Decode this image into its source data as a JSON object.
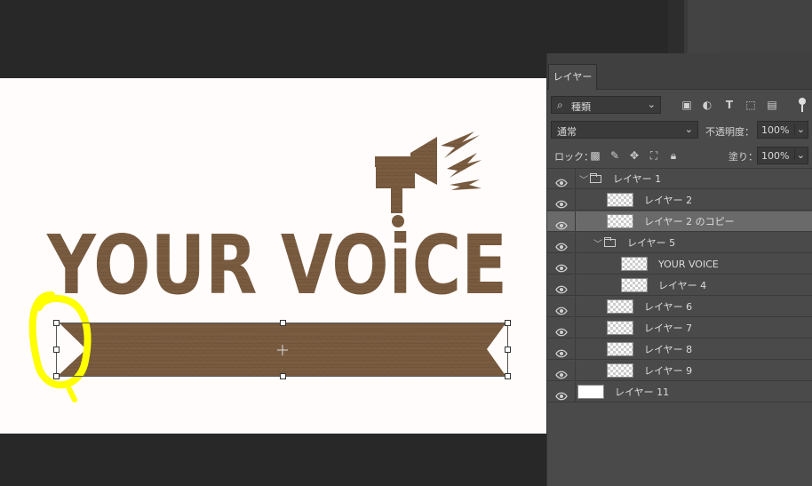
{
  "canvas": {
    "headline": "YOUR VOiCE",
    "text_color": "#7a5c40",
    "annotation_color": "#ffff00"
  },
  "panel": {
    "tab": "レイヤー",
    "filter_search_icon": "search-icon",
    "filter_kind": "種類",
    "blend_mode": "通常",
    "opacity_label": "不透明度：",
    "opacity_value": "100%",
    "lock_label": "ロック：",
    "fill_label": "塗り：",
    "fill_value": "100%",
    "layers": [
      {
        "name": "レイヤー 1",
        "type": "group",
        "indent": 0,
        "expanded": true
      },
      {
        "name": "レイヤー 2",
        "type": "layer",
        "indent": 1
      },
      {
        "name": "レイヤー 2 のコピー",
        "type": "layer",
        "indent": 1,
        "selected": true
      },
      {
        "name": "レイヤー 5",
        "type": "group",
        "indent": 1,
        "expanded": true
      },
      {
        "name": "YOUR VOICE",
        "type": "layer",
        "indent": 2
      },
      {
        "name": "レイヤー 4",
        "type": "layer",
        "indent": 2
      },
      {
        "name": "レイヤー 6",
        "type": "layer",
        "indent": 1
      },
      {
        "name": "レイヤー 7",
        "type": "layer",
        "indent": 1
      },
      {
        "name": "レイヤー 8",
        "type": "layer",
        "indent": 1
      },
      {
        "name": "レイヤー 9",
        "type": "layer",
        "indent": 1
      },
      {
        "name": "レイヤー 11",
        "type": "layer",
        "indent": 0,
        "white": true
      }
    ]
  }
}
